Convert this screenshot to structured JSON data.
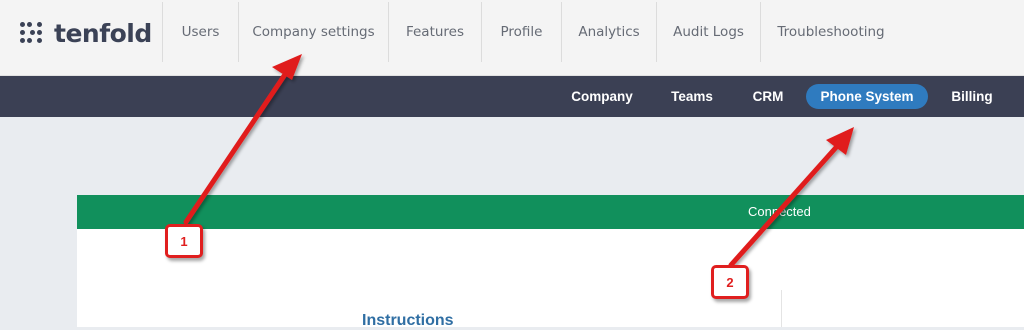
{
  "header": {
    "logo_text": "tenfold",
    "nav": [
      "Users",
      "Company settings",
      "Features",
      "Profile",
      "Analytics",
      "Audit Logs",
      "Troubleshooting"
    ]
  },
  "subnav": {
    "items": [
      "Company",
      "Teams",
      "CRM",
      "Phone System",
      "Billing"
    ],
    "active": "Phone System"
  },
  "panel": {
    "status_text": "Connected",
    "section_title": "Instructions"
  },
  "annotations": {
    "callout_1": "1",
    "callout_2": "2"
  },
  "colors": {
    "subnav_bg": "#3b4054",
    "active_pill": "#2f7bbf",
    "status_green": "#11905c",
    "annotation_red": "#e01f1f"
  }
}
